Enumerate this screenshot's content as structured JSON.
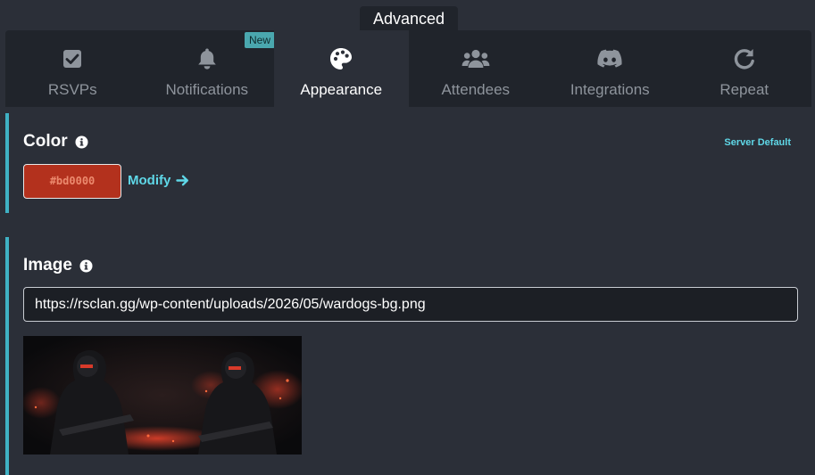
{
  "header": {
    "section_label": "Advanced"
  },
  "tabs": [
    {
      "label": "RSVPs",
      "icon": "checkbox-icon",
      "active": false
    },
    {
      "label": "Notifications",
      "icon": "bell-icon",
      "active": false,
      "badge": "New"
    },
    {
      "label": "Appearance",
      "icon": "palette-icon",
      "active": true
    },
    {
      "label": "Attendees",
      "icon": "users-icon",
      "active": false
    },
    {
      "label": "Integrations",
      "icon": "discord-icon",
      "active": false
    },
    {
      "label": "Repeat",
      "icon": "redo-icon",
      "active": false
    }
  ],
  "color_section": {
    "title": "Color",
    "server_default_label": "Server Default",
    "value": "#bd0000",
    "swatch_color": "#b3311d",
    "modify_label": "Modify"
  },
  "image_section": {
    "title": "Image",
    "url": "https://rsclan.gg/wp-content/uploads/2026/05/wardogs-bg.png"
  },
  "colors": {
    "accent": "#3fb1c4",
    "link": "#5fd8e8",
    "badge": "#4aa7ae",
    "background": "#2b2f38",
    "tabbar": "#20242b"
  }
}
